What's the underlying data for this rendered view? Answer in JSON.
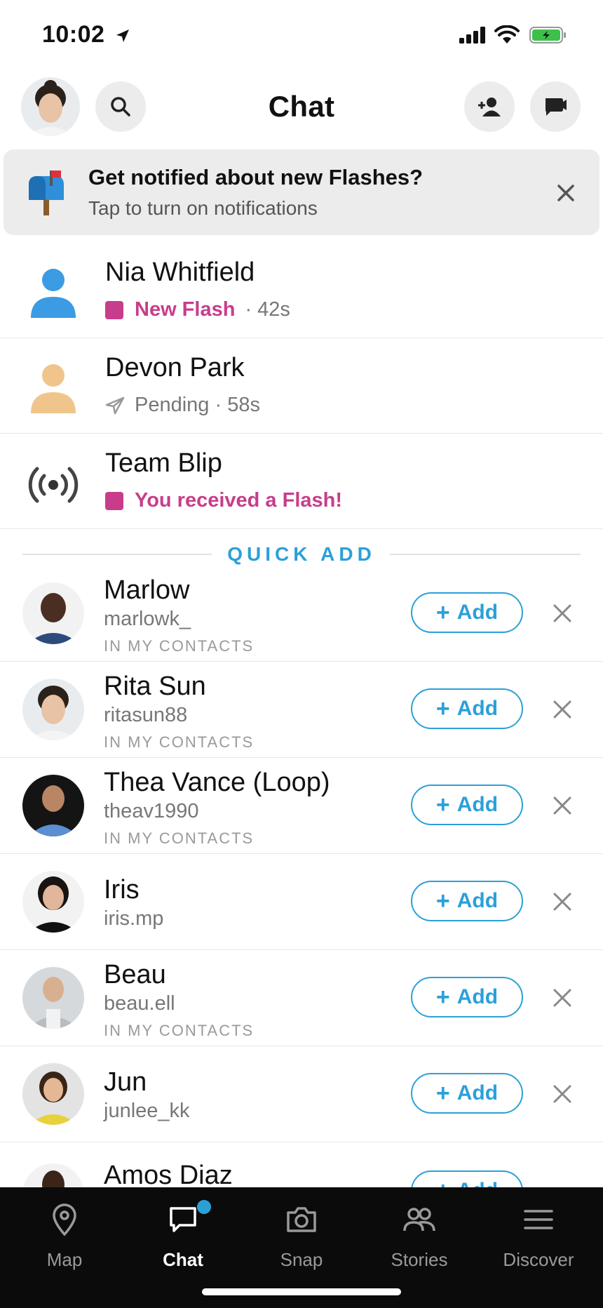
{
  "status_bar": {
    "time": "10:02"
  },
  "header": {
    "title": "Chat"
  },
  "banner": {
    "title": "Get notified about new Flashes?",
    "subtitle": "Tap to turn on notifications"
  },
  "chats": [
    {
      "name": "Nia Whitfield",
      "status": "New Flash",
      "time": "· 42s",
      "icon": "person-icon",
      "color": "#3b9be3"
    },
    {
      "name": "Devon Park",
      "status": "Pending · 58s",
      "icon": "person-icon",
      "color": "#f0c58c"
    },
    {
      "name": "Team Blip",
      "status": "You received a Flash!",
      "icon": "broadcast-icon"
    }
  ],
  "quick_add": {
    "heading": "QUICK ADD",
    "add_label": "Add",
    "items": [
      {
        "name": "Marlow",
        "username": "marlowk_",
        "tag": "IN MY CONTACTS"
      },
      {
        "name": "Rita Sun",
        "username": "ritasun88",
        "tag": "IN MY CONTACTS"
      },
      {
        "name": "Thea Vance (Loop)",
        "username": "theav1990",
        "tag": "IN MY CONTACTS"
      },
      {
        "name": "Iris",
        "username": "iris.mp",
        "tag": ""
      },
      {
        "name": "Beau",
        "username": "beau.ell",
        "tag": "IN MY CONTACTS"
      },
      {
        "name": "Jun",
        "username": "junlee_kk",
        "tag": ""
      },
      {
        "name": "Amos Diaz",
        "username": "",
        "tag": ""
      }
    ]
  },
  "tabs": [
    {
      "label": "Map",
      "icon": "map-pin-icon"
    },
    {
      "label": "Chat",
      "icon": "chat-bubble-icon",
      "active": true
    },
    {
      "label": "Snap",
      "icon": "camera-icon"
    },
    {
      "label": "Stories",
      "icon": "stories-icon"
    },
    {
      "label": "Discover",
      "icon": "menu-icon"
    }
  ],
  "colors": {
    "accent": "#2ba0d8",
    "flash": "#c83d8b",
    "tab_bar": "#0b0b0b"
  }
}
